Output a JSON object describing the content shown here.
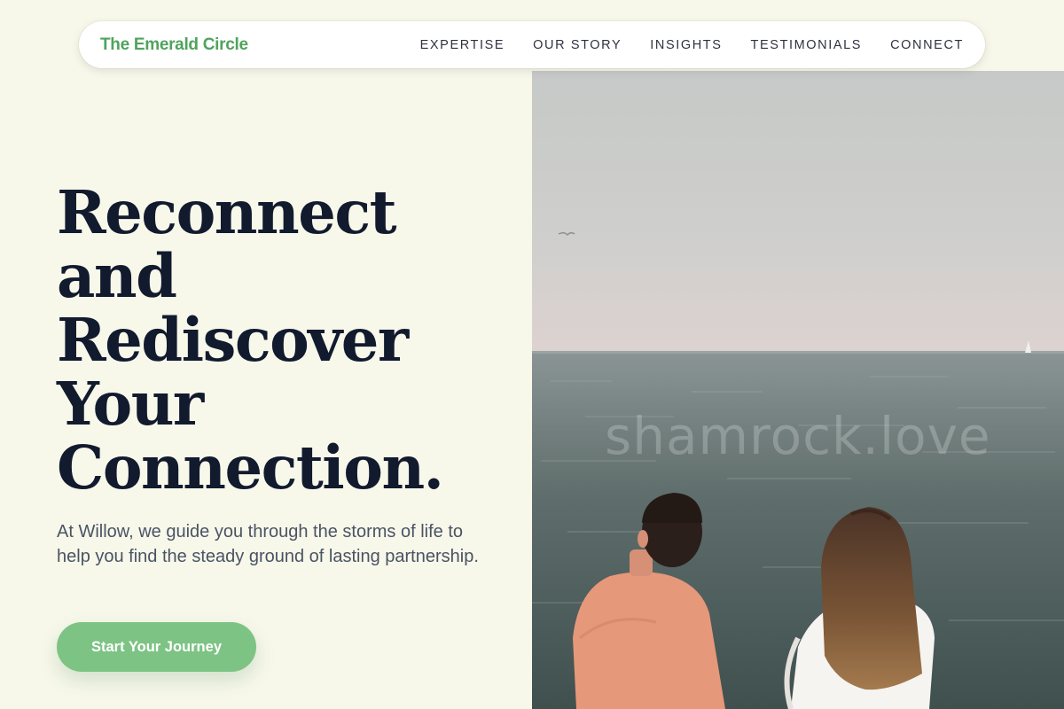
{
  "header": {
    "brand": "The Emerald Circle",
    "nav": [
      {
        "label": "EXPERTISE"
      },
      {
        "label": "OUR STORY"
      },
      {
        "label": "INSIGHTS"
      },
      {
        "label": "TESTIMONIALS"
      },
      {
        "label": "CONNECT"
      }
    ]
  },
  "hero": {
    "title_lines": [
      "Reconnect",
      "and",
      "Rediscover",
      "Your",
      "Connection."
    ],
    "description": "At Willow, we guide you through the storms of life to help you find the steady ground of lasting partnership.",
    "cta_label": "Start Your Journey",
    "image": {
      "subject": "couple-at-sea-photo",
      "watermark": "shamrock.love"
    }
  },
  "colors": {
    "background": "#f7f8ea",
    "brand": "#4fa35d",
    "cta": "#7dc384",
    "heading": "#121a2e",
    "body_text": "#4a5364"
  }
}
